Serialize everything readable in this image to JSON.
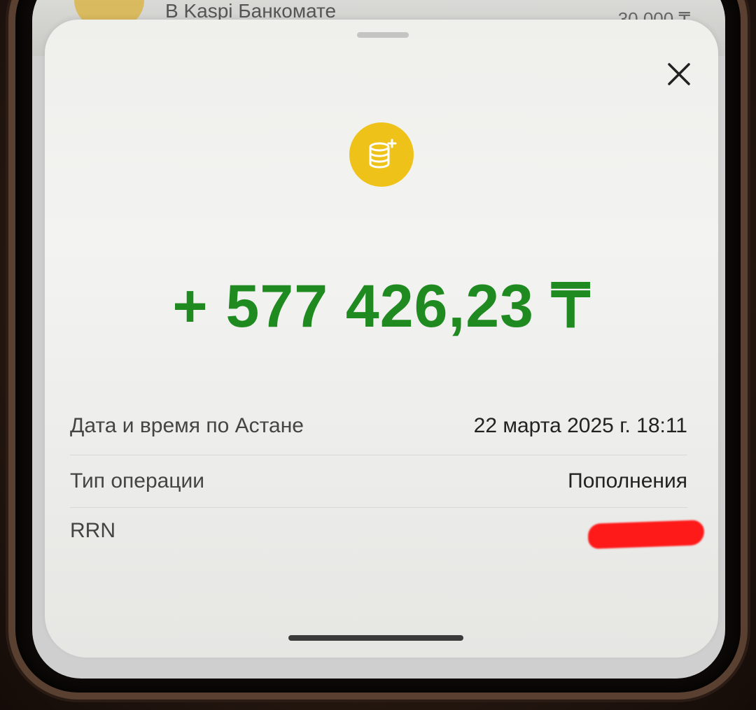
{
  "background": {
    "row_title": "В Kaspi Банкомате",
    "row_amount": "30 000 ₸"
  },
  "operation": {
    "icon": "coins-plus-icon",
    "amount": "+ 577 426,23 ₸",
    "amount_color": "#1f8a1f",
    "icon_color": "#efc21a"
  },
  "details": [
    {
      "label": "Дата и время по Астане",
      "value": "22 марта 2025 г. 18:11"
    },
    {
      "label": "Тип операции",
      "value": "Пополнения"
    },
    {
      "label": "RRN",
      "value": ""
    }
  ],
  "redaction_color": "#ff1a1a"
}
